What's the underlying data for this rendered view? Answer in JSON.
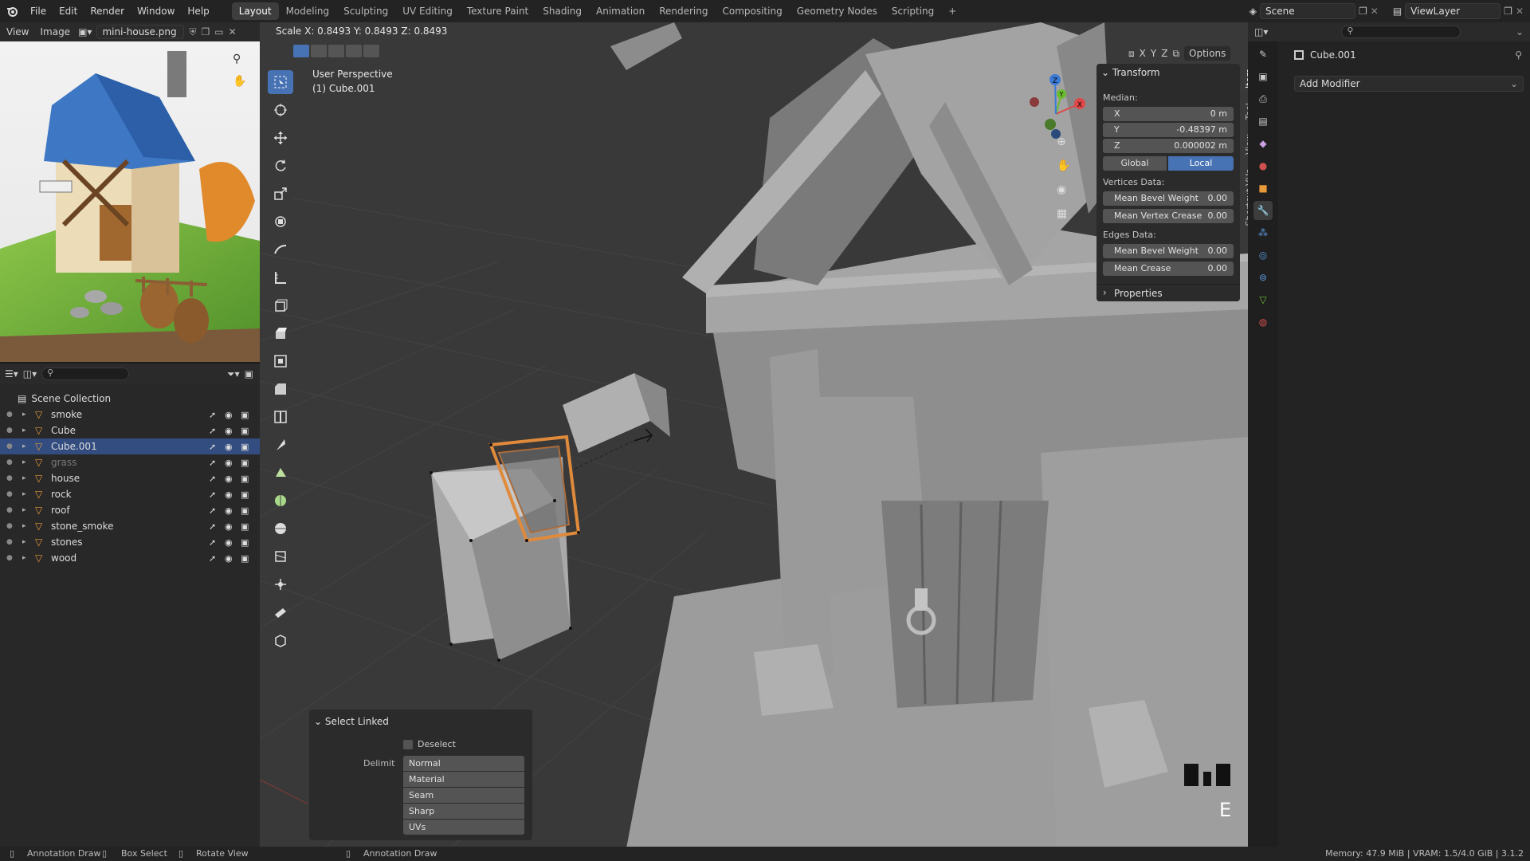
{
  "menus": [
    "File",
    "Edit",
    "Render",
    "Window",
    "Help"
  ],
  "workspaces": [
    {
      "label": "Layout",
      "active": true
    },
    {
      "label": "Modeling",
      "active": false
    },
    {
      "label": "Sculpting",
      "active": false
    },
    {
      "label": "UV Editing",
      "active": false
    },
    {
      "label": "Texture Paint",
      "active": false
    },
    {
      "label": "Shading",
      "active": false
    },
    {
      "label": "Animation",
      "active": false
    },
    {
      "label": "Rendering",
      "active": false
    },
    {
      "label": "Compositing",
      "active": false
    },
    {
      "label": "Geometry Nodes",
      "active": false
    },
    {
      "label": "Scripting",
      "active": false
    }
  ],
  "add_workspace": "+",
  "scene": {
    "name": "Scene",
    "view_layer": "ViewLayer"
  },
  "image_editor": {
    "menu_view": "View",
    "menu_image": "Image",
    "image_name": "mini-house.png"
  },
  "outliner": {
    "root": "Scene Collection",
    "rows": [
      {
        "name": "smoke",
        "selected": false,
        "dim": false
      },
      {
        "name": "Cube",
        "selected": false,
        "dim": false
      },
      {
        "name": "Cube.001",
        "selected": true,
        "dim": false
      },
      {
        "name": "grass",
        "selected": false,
        "dim": true
      },
      {
        "name": "house",
        "selected": false,
        "dim": false
      },
      {
        "name": "rock",
        "selected": false,
        "dim": false
      },
      {
        "name": "roof",
        "selected": false,
        "dim": false
      },
      {
        "name": "stone_smoke",
        "selected": false,
        "dim": false
      },
      {
        "name": "stones",
        "selected": false,
        "dim": false
      },
      {
        "name": "wood",
        "selected": false,
        "dim": false
      }
    ]
  },
  "viewport": {
    "scale_readout": "Scale X: 0.8493   Y: 0.8493   Z: 0.8493",
    "perspective": "User Perspective",
    "object_info": "(1) Cube.001",
    "options_label": "Options",
    "axes": [
      "X",
      "Y",
      "Z"
    ],
    "key_overlay": "E"
  },
  "npanel": {
    "tabs": [
      "Item",
      "Tool",
      "View",
      "Shortcut VUr"
    ],
    "transform_title": "Transform",
    "median_label": "Median:",
    "x_label": "X",
    "x_value": "0 m",
    "y_label": "Y",
    "y_value": "-0.48397 m",
    "z_label": "Z",
    "z_value": "0.000002 m",
    "global_label": "Global",
    "local_label": "Local",
    "vertices_label": "Vertices Data:",
    "mean_bevel_weight_label": "Mean Bevel Weight",
    "mean_bevel_weight_v": "0.00",
    "mean_vertex_crease_label": "Mean Vertex Crease",
    "mean_vertex_crease_v": "0.00",
    "edges_label": "Edges Data:",
    "edge_bevel_weight_label": "Mean Bevel Weight",
    "edge_bevel_weight_v": "0.00",
    "mean_crease_label": "Mean Crease",
    "mean_crease_v": "0.00",
    "properties_title": "Properties"
  },
  "operator": {
    "title": "Select Linked",
    "deselect": "Deselect",
    "delimit_label": "Delimit",
    "delimit_options": [
      "Normal",
      "Material",
      "Seam",
      "Sharp",
      "UVs"
    ]
  },
  "properties": {
    "object_name": "Cube.001",
    "add_modifier": "Add Modifier"
  },
  "statusbar": {
    "hint1": "Annotation Draw",
    "hint2": "Box Select",
    "hint3": "Rotate View",
    "hint4": "Annotation Draw",
    "memory": "Memory: 47.9 MiB | VRAM: 1.5/4.0 GiB | 3.1.2"
  },
  "colors": {
    "accent": "#4772b3",
    "selected_row": "#334d80",
    "viewport_bg": "#393939",
    "mesh": "#a8a8a8",
    "selection": "#e08a3c"
  }
}
